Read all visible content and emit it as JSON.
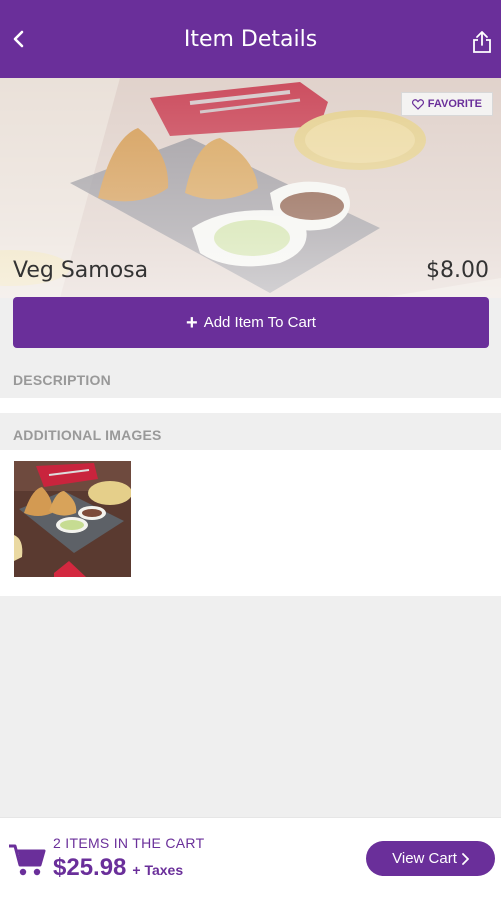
{
  "header": {
    "title": "Item Details",
    "back_icon": "back-arrow-icon",
    "share_icon": "share-icon"
  },
  "hero": {
    "favorite_label": "FAVORITE",
    "favorite_icon": "heart-icon"
  },
  "item": {
    "name": "Veg Samosa",
    "price": "$8.00"
  },
  "add_to_cart": {
    "label": "Add Item To Cart"
  },
  "sections": {
    "description_label": "DESCRIPTION",
    "additional_images_label": "ADDITIONAL IMAGES"
  },
  "cart": {
    "count_text": "2 ITEMS IN THE CART",
    "total": "$25.98",
    "taxes_text": "+ Taxes",
    "view_cart_label": "View Cart"
  },
  "colors": {
    "brand": "#6a2f9a",
    "muted_text": "#999999",
    "background": "#efefef"
  }
}
